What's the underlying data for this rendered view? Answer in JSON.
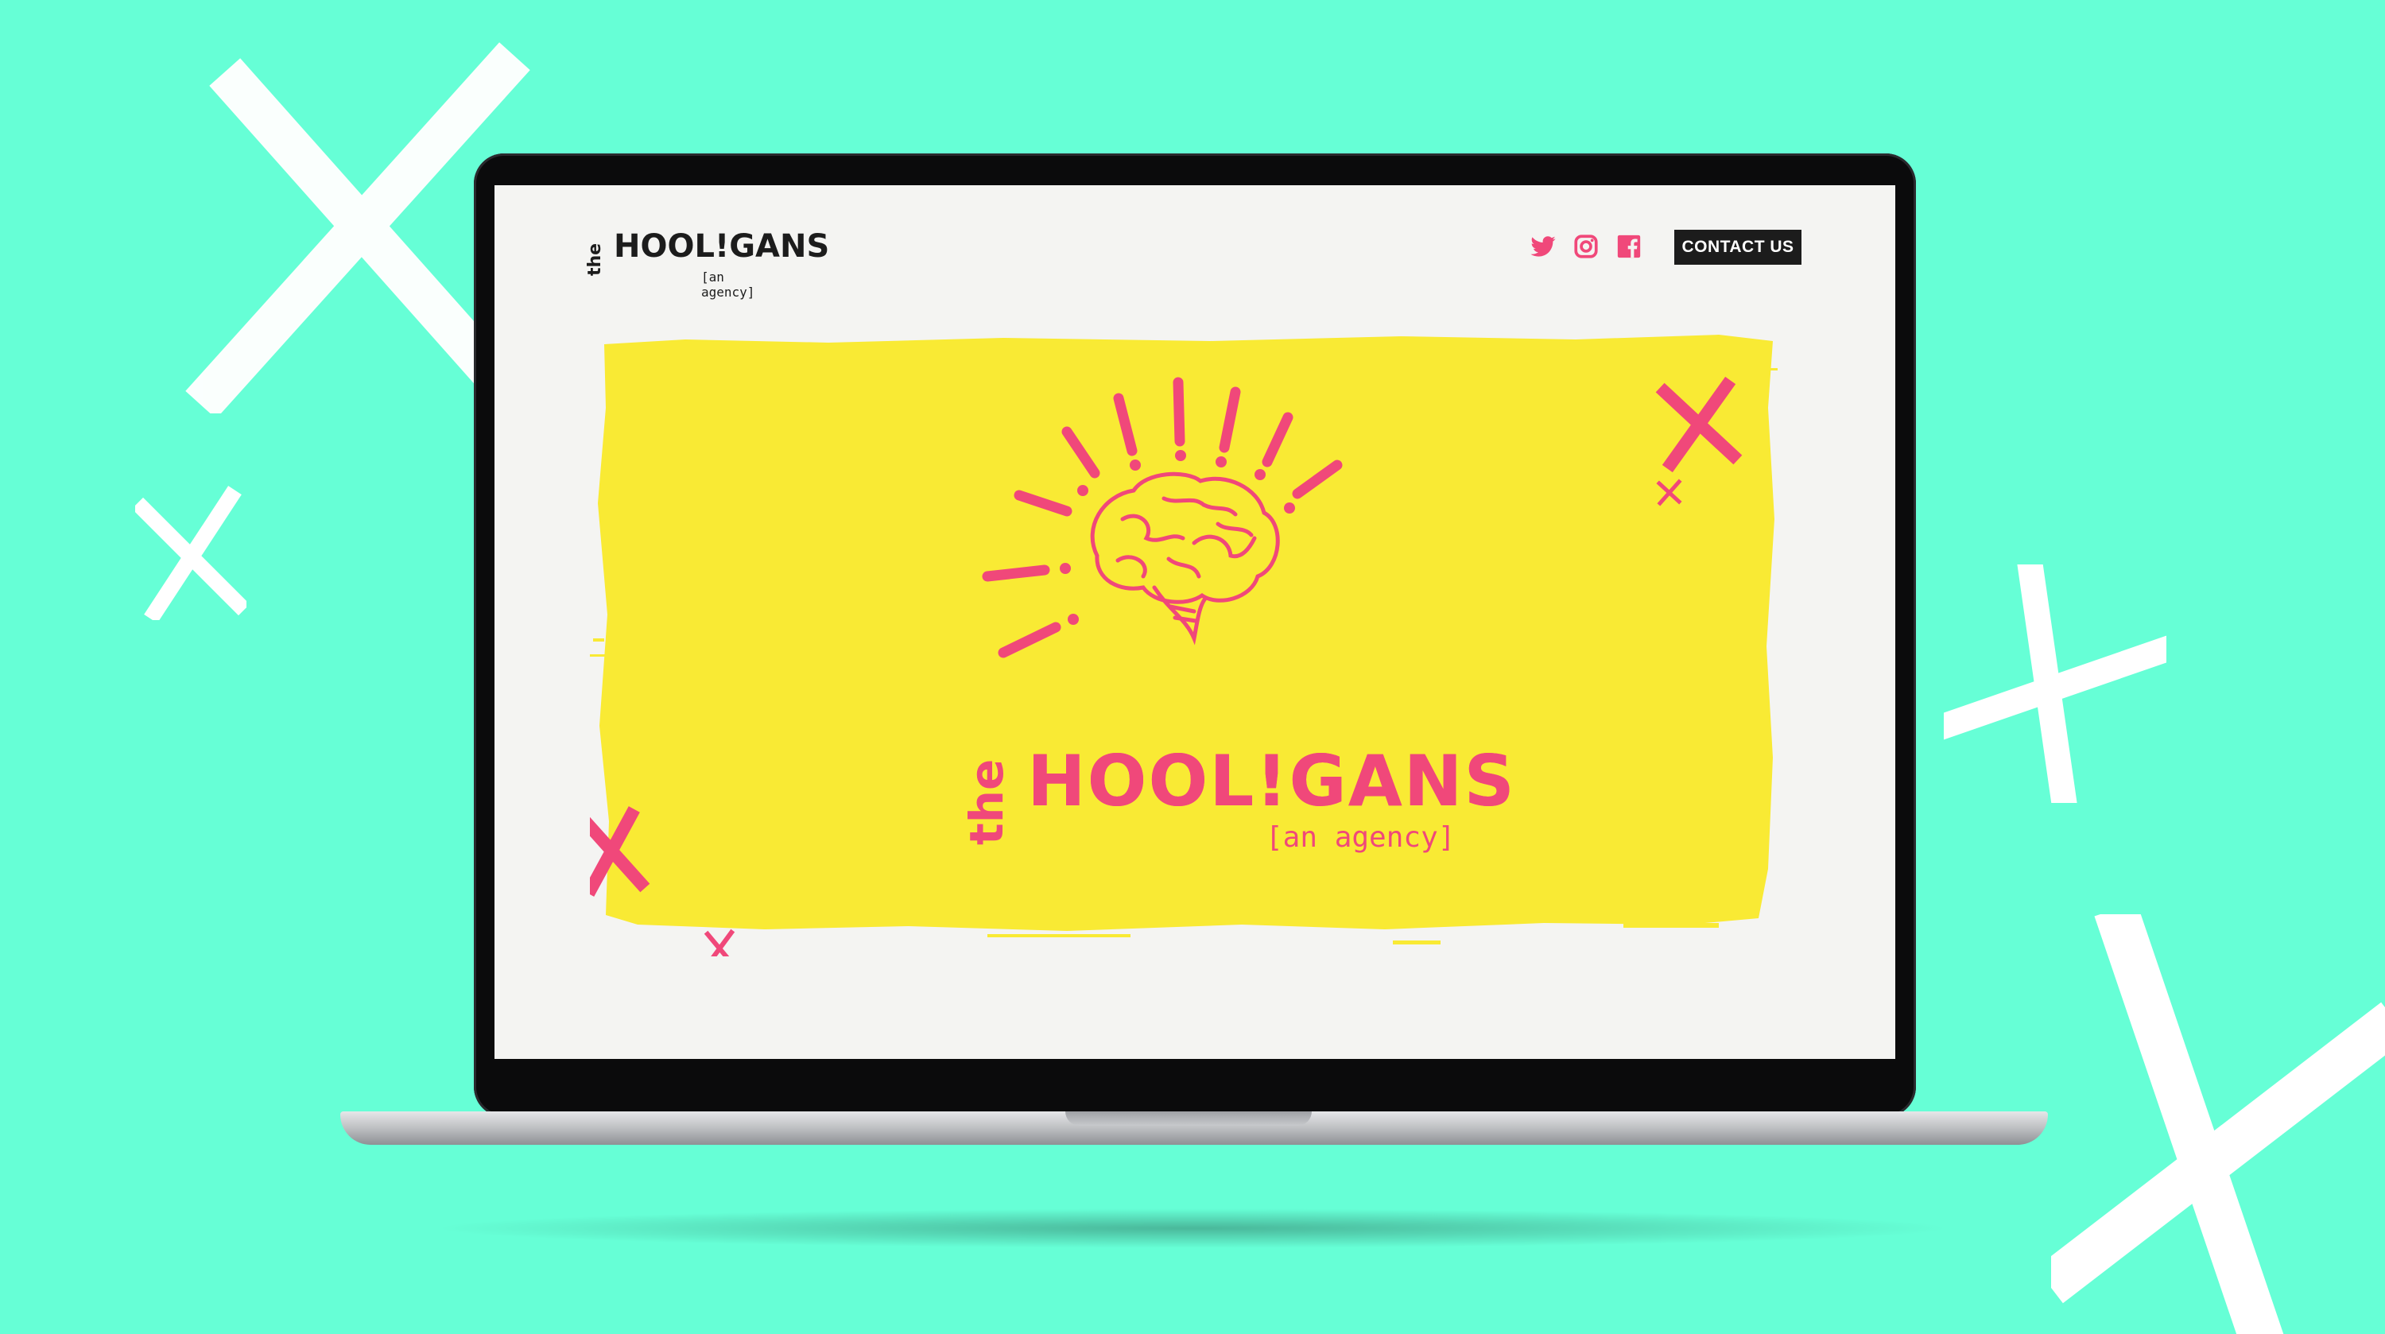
{
  "brand": {
    "name": "HOOL!GANS",
    "prefix": "the",
    "tagline": "[an agency]"
  },
  "header": {
    "social": [
      {
        "name": "twitter-icon"
      },
      {
        "name": "instagram-icon"
      },
      {
        "name": "facebook-icon"
      }
    ],
    "contact_label": "CONTACT US"
  },
  "colors": {
    "background": "#66ffd6",
    "accent_pink": "#f0487a",
    "hero_yellow": "#f9ea34",
    "screen_bg": "#f4f4f2",
    "button_dark": "#1c1c1c",
    "deco_white": "#ffffff"
  }
}
